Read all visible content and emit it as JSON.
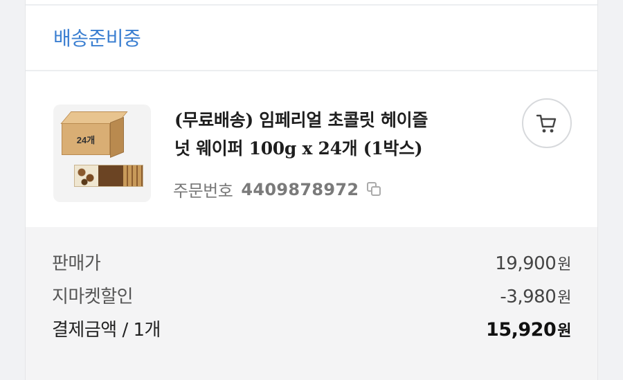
{
  "status": "배송준비중",
  "product": {
    "box_label": "24개",
    "title_line1": "(무료배송) 임페리얼 초콜릿 헤이즐",
    "title_line2": "넛 웨이퍼 100g x 24개 (1박스)",
    "order_label": "주문번호",
    "order_number": "4409878972"
  },
  "summary": {
    "rows": [
      {
        "label": "판매가",
        "amount": "19,900",
        "unit": "원"
      },
      {
        "label": "지마켓할인",
        "amount": "-3,980",
        "unit": "원"
      },
      {
        "label": "결제금액 / 1개",
        "amount": "15,920",
        "unit": "원"
      }
    ]
  },
  "icons": {
    "cart": "cart-icon",
    "copy": "copy-icon"
  },
  "colors": {
    "status": "#3b7fd1",
    "summary_bg": "#f4f4f5"
  }
}
